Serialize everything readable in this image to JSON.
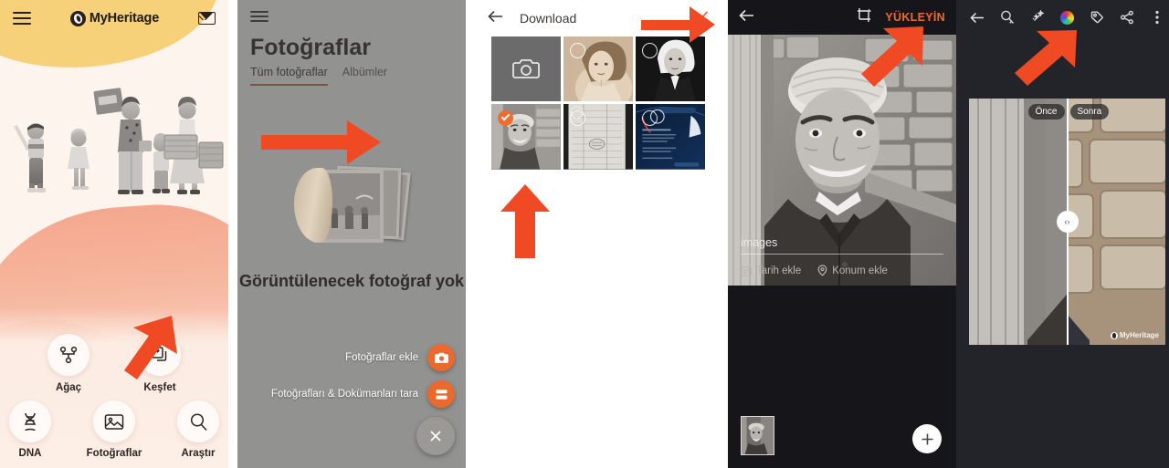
{
  "panel1": {
    "name": "myheritage-home",
    "header": {
      "menu_icon": "hamburger-icon",
      "brand": "MyHeritage",
      "mail_icon": "envelope-icon"
    },
    "nav_row1": [
      {
        "label": "Ağaç",
        "icon": "family-tree-icon"
      },
      {
        "label": "Keşfet",
        "icon": "discover-cards-icon"
      }
    ],
    "nav_row2": [
      {
        "label": "DNA",
        "icon": "dna-helix-icon"
      },
      {
        "label": "Fotoğraflar",
        "icon": "photo-icon"
      },
      {
        "label": "Araştır",
        "icon": "search-icon"
      }
    ],
    "colors": {
      "bg": "#fdf4ee",
      "yellow": "#f7d07a",
      "peach": "#f4a88e"
    }
  },
  "panel2": {
    "name": "photos-empty-state",
    "menu_icon": "hamburger-icon",
    "title": "Fotoğraflar",
    "tabs": [
      {
        "label": "Tüm fotoğraflar",
        "active": true
      },
      {
        "label": "Albümler",
        "active": false
      }
    ],
    "empty_text": "Görüntülenecek fotoğraf yok",
    "fab_items": [
      {
        "label": "Fotoğraflar ekle",
        "icon": "camera-icon"
      },
      {
        "label": "Fotoğrafları & Dokümanları tara",
        "icon": "scanner-icon"
      }
    ],
    "close_icon": "close-icon",
    "accent": "#ea6a2e"
  },
  "panel3": {
    "name": "download-photo-picker",
    "back_icon": "back-arrow-icon",
    "title": "Download",
    "confirm_icon": "check-icon",
    "confirm_color": "#ee6c2d",
    "cells": [
      {
        "kind": "camera",
        "label": "camera-tile",
        "selected": false
      },
      {
        "kind": "portrait",
        "label": "sepia-woman-photo",
        "selected": false
      },
      {
        "kind": "nun",
        "label": "bw-woman-photo",
        "selected": false
      },
      {
        "kind": "oldman",
        "label": "elderly-man-photo",
        "selected": true
      },
      {
        "kind": "doc",
        "label": "document-scan",
        "selected": false
      },
      {
        "kind": "ad",
        "label": "dna-ad-image",
        "selected": false
      }
    ]
  },
  "panel4": {
    "name": "upload-photo-detail",
    "back_icon": "back-arrow-icon",
    "crop_icon": "crop-rotate-icon",
    "upload_label": "YÜKLEYİN",
    "upload_color": "#ee6a2b",
    "filename": "images",
    "meta": [
      {
        "label": "Tarih ekle",
        "icon": "calendar-icon"
      },
      {
        "label": "Konum ekle",
        "icon": "location-pin-icon"
      }
    ],
    "thumbnail": "elderly-man-thumbnail",
    "add_icon": "plus-icon"
  },
  "panel5": {
    "name": "photo-colorize-compare",
    "toolbar": [
      {
        "icon": "back-arrow-icon",
        "name": "back-button"
      },
      {
        "icon": "zoom-icon",
        "name": "zoom-button"
      },
      {
        "icon": "magic-wand-icon",
        "name": "enhance-button"
      },
      {
        "icon": "color-wheel-icon",
        "name": "colorize-button"
      },
      {
        "icon": "tag-icon",
        "name": "tag-button"
      },
      {
        "icon": "share-icon",
        "name": "share-button"
      },
      {
        "icon": "more-vertical-icon",
        "name": "more-button"
      }
    ],
    "before_label": "Önce",
    "after_label": "Sonra",
    "handle_glyph": "‹›",
    "watermark": "MyHeritage"
  }
}
